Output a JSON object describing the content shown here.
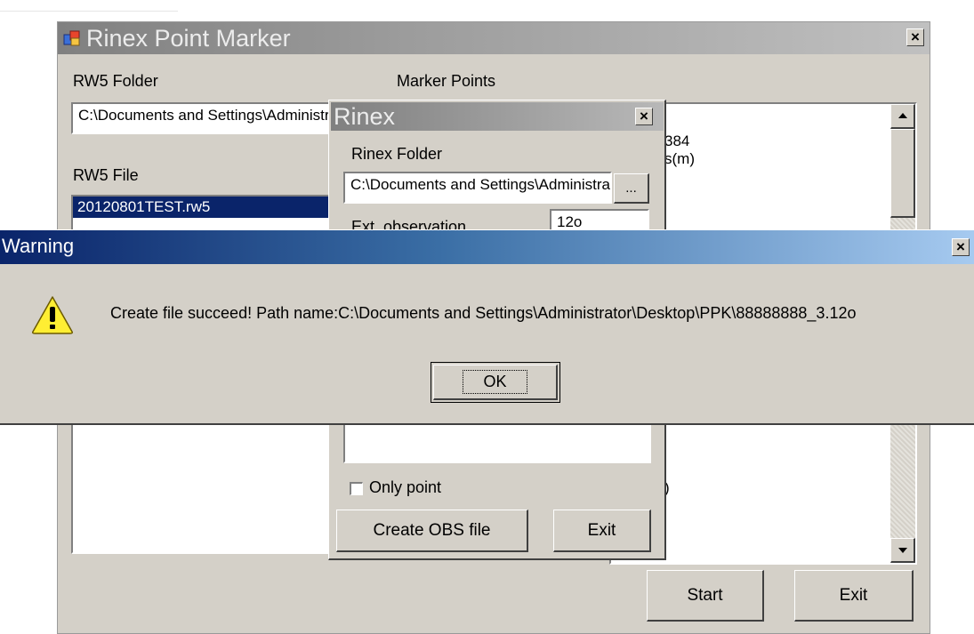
{
  "main_window": {
    "title": "Rinex Point Marker",
    "close_glyph": "×",
    "rw5_folder_label": "RW5 Folder",
    "rw5_folder_value": "C:\\Documents and Settings\\Administrator\\Desktop\\PPK",
    "rw5_file_label": "RW5 File",
    "rw5_files": [
      "20120801TEST.rw5"
    ],
    "marker_points_label": "Marker Points",
    "marker_points_visible": [
      "384",
      "s(m)",
      ")"
    ],
    "start_button": "Start",
    "exit_button": "Exit"
  },
  "rinex_dialog": {
    "title": "Rinex",
    "close_glyph": "×",
    "rinex_folder_label": "Rinex Folder",
    "rinex_folder_value": "C:\\Documents and Settings\\Administrator\\Desktop\\PPK",
    "browse_button": "...",
    "ext_observation_label": "Ext. observation",
    "ext_observation_value": "12o",
    "only_point_label": "Only point",
    "only_point_checked": false,
    "create_obs_button": "Create OBS file",
    "exit_button": "Exit"
  },
  "warning_dialog": {
    "title": "Warning",
    "close_glyph": "×",
    "icon": "warning-icon",
    "message": "Create file succeed! Path name:C:\\Documents and Settings\\Administrator\\Desktop\\PPK\\88888888_3.12o",
    "ok_button": "OK"
  },
  "colors": {
    "dialog_face": "#d4d0c8",
    "active_title_start": "#0a246a",
    "active_title_end": "#a6caf0",
    "inactive_title": "#808080",
    "selection": "#0a246a"
  }
}
